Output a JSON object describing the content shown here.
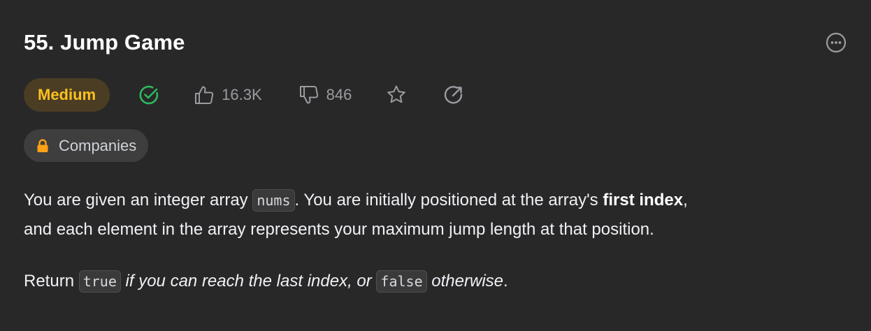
{
  "problem": {
    "title": "55. Jump Game",
    "difficulty": "Medium",
    "likes": "16.3K",
    "dislikes": "846",
    "companies_label": "Companies"
  },
  "icons": {
    "more": "more-horizontal-icon",
    "solved": "check-circle-icon",
    "like": "thumbs-up-icon",
    "dislike": "thumbs-down-icon",
    "favorite": "star-icon",
    "share": "share-arrow-icon",
    "lock": "lock-icon"
  },
  "colors": {
    "background": "#282828",
    "difficulty_text": "#ffc01e",
    "difficulty_bg": "#4a3d24",
    "solved_green": "#2cbb5d",
    "lock_orange": "#ffa116",
    "muted": "#9a9ca1"
  },
  "description": {
    "p1_a": "You are given an integer array ",
    "p1_code": "nums",
    "p1_b": ". You are initially positioned at the array's ",
    "p1_bold": "first index",
    "p1_c": ",",
    "p1_d": "and each element in the array represents your maximum jump length at that position.",
    "p2_a": "Return ",
    "p2_code1": "true",
    "p2_italic1": " if you can reach the last index, or ",
    "p2_code2": "false",
    "p2_italic2": " otherwise",
    "p2_end": "."
  }
}
